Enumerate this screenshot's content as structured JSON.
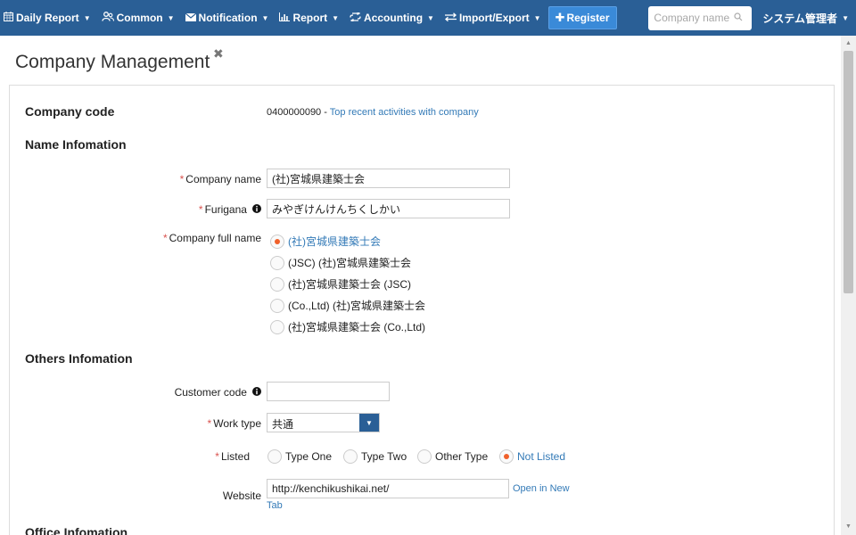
{
  "nav": {
    "items": [
      {
        "label": "Daily Report",
        "icon": "calendar-icon"
      },
      {
        "label": "Common",
        "icon": "users-icon"
      },
      {
        "label": "Notification",
        "icon": "envelope-icon"
      },
      {
        "label": "Report",
        "icon": "bar-chart-icon"
      },
      {
        "label": "Accounting",
        "icon": "exchange-icon"
      },
      {
        "label": "Import/Export",
        "icon": "import-export-icon"
      }
    ],
    "register_label": "Register",
    "search_placeholder": "Company name",
    "user_label": "システム管理者"
  },
  "page": {
    "title": "Company Management",
    "company_code_label": "Company code",
    "company_code_value": "0400000090",
    "company_code_sep": "-",
    "recent_activities_link": "Top recent activities with company"
  },
  "name_info": {
    "heading": "Name Infomation",
    "company_name_label": "Company name",
    "company_name_value": "(社)宮城県建築士会",
    "furigana_label": "Furigana",
    "furigana_value": "みやぎけんけんちくしかい",
    "full_name_label": "Company full name",
    "full_name_options": [
      {
        "label": "(社)宮城県建築士会",
        "checked": true
      },
      {
        "label": "(JSC) (社)宮城県建築士会",
        "checked": false
      },
      {
        "label": "(社)宮城県建築士会 (JSC)",
        "checked": false
      },
      {
        "label": "(Co.,Ltd) (社)宮城県建築士会",
        "checked": false
      },
      {
        "label": "(社)宮城県建築士会 (Co.,Ltd)",
        "checked": false
      }
    ]
  },
  "others_info": {
    "heading": "Others Infomation",
    "customer_code_label": "Customer code",
    "customer_code_value": "",
    "work_type_label": "Work type",
    "work_type_value": "共通",
    "listed_label": "Listed",
    "listed_options": [
      {
        "label": "Type One",
        "checked": false
      },
      {
        "label": "Type Two",
        "checked": false
      },
      {
        "label": "Other Type",
        "checked": false
      },
      {
        "label": "Not Listed",
        "checked": true
      }
    ],
    "website_label": "Website",
    "website_value": "http://kenchikushikai.net/",
    "open_new_tab_line1": "Open in New",
    "open_new_tab_line2": "Tab"
  },
  "office_info": {
    "heading": "Office Infomation"
  },
  "colors": {
    "navbar": "#2a5f96",
    "link": "#337ab7",
    "required": "#d9534f",
    "radio_checked": "#f0602a"
  }
}
